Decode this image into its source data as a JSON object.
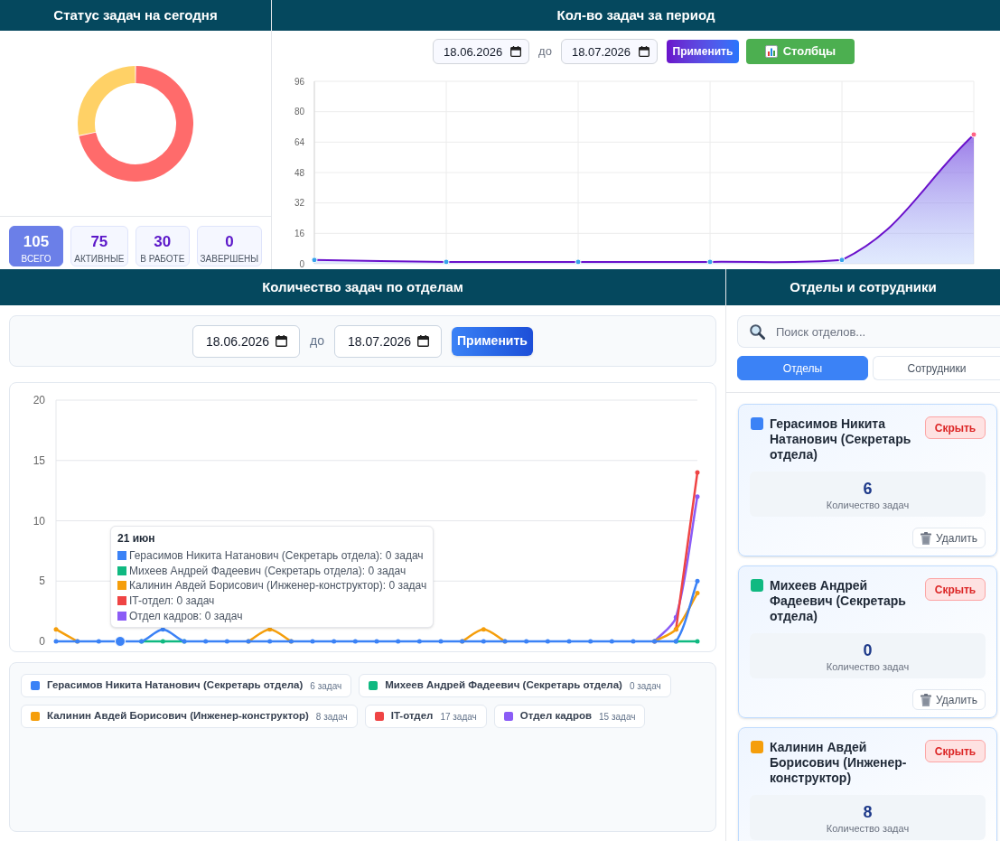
{
  "status_panel": {
    "title": "Статус задач на сегодня",
    "stats": [
      {
        "value": "105",
        "label": "ВСЕГО",
        "selected": true
      },
      {
        "value": "75",
        "label": "АКТИВНЫЕ",
        "selected": false
      },
      {
        "value": "30",
        "label": "В РАБОТЕ",
        "selected": false
      },
      {
        "value": "0",
        "label": "ЗАВЕРШЕНЫ",
        "selected": false
      }
    ]
  },
  "period_panel": {
    "title": "Кол-во задач за период",
    "date_from": "18.06.2026",
    "separator": "до",
    "date_to": "18.07.2026",
    "apply_button": "Применить",
    "view_button": "Столбцы",
    "chart_data": {
      "type": "area",
      "ylim": [
        0,
        96
      ],
      "yticks": [
        0,
        16,
        32,
        48,
        64,
        80,
        96
      ],
      "grid": true,
      "series": [
        {
          "color": "#6a11cb",
          "values": [
            2,
            1,
            1,
            1,
            2,
            68
          ]
        }
      ]
    }
  },
  "departments_chart_panel": {
    "title": "Количество задач по отделам",
    "date_from": "18.06.2026",
    "separator": "до",
    "date_to": "18.07.2026",
    "apply_button": "Применить",
    "chart_data": {
      "type": "line",
      "ylim": [
        0,
        20
      ],
      "yticks": [
        0,
        5,
        10,
        15,
        20
      ],
      "grid": true,
      "series": [
        {
          "name": "Герасимов Никита Натанович (Секретарь отдела)",
          "color": "#3b82f6",
          "values": [
            0,
            0,
            0,
            0,
            0,
            1,
            0,
            0,
            0,
            0,
            0,
            0,
            0,
            0,
            0,
            0,
            0,
            0,
            0,
            0,
            0,
            0,
            0,
            0,
            0,
            0,
            0,
            0,
            0,
            0,
            5
          ]
        },
        {
          "name": "Михеев Андрей Фадеевич (Секретарь отдела)",
          "color": "#10b981",
          "values": [
            null,
            null,
            null,
            null,
            0,
            0,
            0,
            null,
            null,
            null,
            null,
            null,
            null,
            null,
            null,
            null,
            null,
            null,
            null,
            null,
            null,
            null,
            null,
            null,
            null,
            null,
            null,
            null,
            null,
            0,
            0
          ]
        },
        {
          "name": "Калинин Авдей Борисович (Инженер-конструктор)",
          "color": "#f59e0b",
          "values": [
            1,
            0,
            null,
            null,
            null,
            null,
            null,
            null,
            null,
            0,
            1,
            0,
            null,
            null,
            null,
            null,
            null,
            null,
            null,
            0,
            1,
            0,
            null,
            null,
            null,
            null,
            null,
            null,
            0,
            1,
            4
          ]
        },
        {
          "name": "IT-отдел",
          "color": "#ef4444",
          "values": [
            null,
            null,
            null,
            null,
            null,
            null,
            null,
            null,
            null,
            null,
            null,
            null,
            null,
            null,
            null,
            null,
            null,
            null,
            null,
            null,
            null,
            null,
            null,
            null,
            null,
            null,
            null,
            null,
            null,
            1,
            14
          ]
        },
        {
          "name": "Отдел кадров",
          "color": "#8b5cf6",
          "values": [
            null,
            null,
            null,
            null,
            null,
            null,
            null,
            null,
            null,
            null,
            null,
            null,
            null,
            null,
            null,
            null,
            null,
            null,
            null,
            null,
            null,
            null,
            null,
            null,
            null,
            null,
            null,
            null,
            0,
            2,
            12
          ]
        }
      ]
    },
    "tooltip": {
      "title": "21 июн",
      "lines": [
        {
          "text": "Герасимов Никита Натанович (Секретарь отдела): 0 задач",
          "color": "#3b82f6"
        },
        {
          "text": "Михеев Андрей Фадеевич (Секретарь отдела): 0 задач",
          "color": "#10b981"
        },
        {
          "text": "Калинин Авдей Борисович (Инженер-конструктор): 0 задач",
          "color": "#f59e0b"
        },
        {
          "text": "IT-отдел: 0 задач",
          "color": "#ef4444"
        },
        {
          "text": "Отдел кадров: 0 задач",
          "color": "#8b5cf6"
        }
      ]
    },
    "legend": [
      {
        "count": "6 задач"
      },
      {
        "count": "0 задач"
      },
      {
        "count": "8 задач"
      },
      {
        "count": "17 задач"
      },
      {
        "count": "15 задач"
      }
    ]
  },
  "sidebar": {
    "title": "Отделы и сотрудники",
    "search": {
      "placeholder": "Поиск отделов..."
    },
    "tabs": [
      {
        "label": "Отделы",
        "selected": true
      },
      {
        "label": "Сотрудники",
        "selected": false
      }
    ],
    "cards": [
      {
        "name": "Герасимов Никита Натанович (Секретарь отдела)",
        "color": "#3b82f6",
        "hide_button": "Скрыть",
        "count": "6",
        "count_label": "Количество задач",
        "delete_button": "Удалить"
      },
      {
        "name": "Михеев Андрей Фадеевич (Секретарь отдела)",
        "color": "#10b981",
        "hide_button": "Скрыть",
        "count": "0",
        "count_label": "Количество задач",
        "delete_button": "Удалить"
      },
      {
        "name": "Калинин Авдей Борисович (Инженер-конструктор)",
        "color": "#f59e0b",
        "hide_button": "Скрыть",
        "count": "8",
        "count_label": "Количество задач"
      }
    ]
  }
}
